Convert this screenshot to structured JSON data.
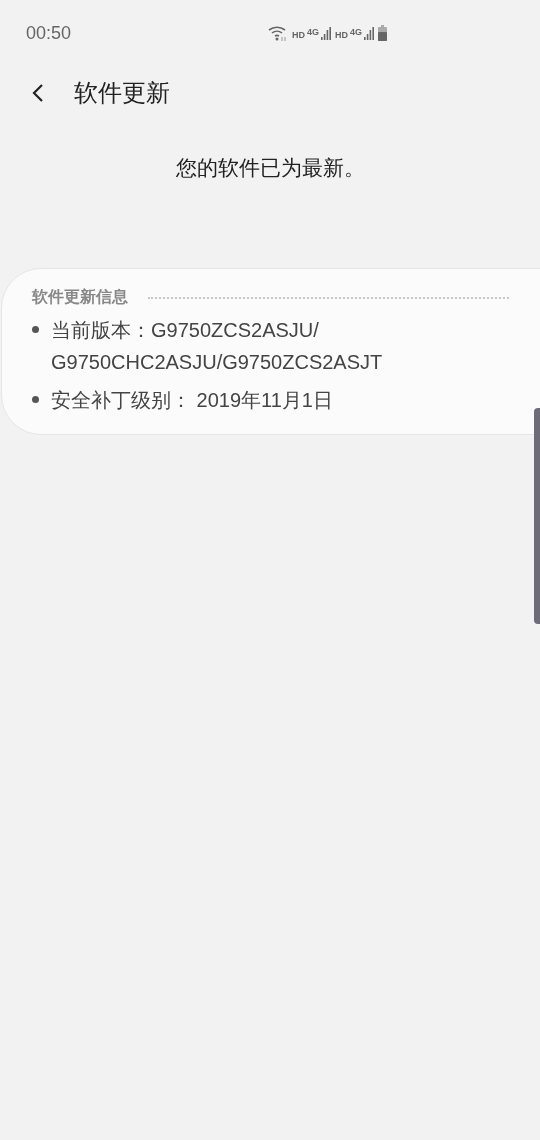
{
  "status_bar": {
    "time": "00:50",
    "networks": [
      {
        "hd": "HD",
        "type": "4G"
      },
      {
        "hd": "HD",
        "type": "4G"
      }
    ]
  },
  "header": {
    "title": "软件更新"
  },
  "message": "您的软件已为最新。",
  "info_card": {
    "title": "软件更新信息",
    "items": [
      "当前版本：G9750ZCS2ASJU/G9750CHC2ASJU/G9750ZCS2ASJT",
      "安全补丁级别： 2019年11月1日"
    ]
  }
}
